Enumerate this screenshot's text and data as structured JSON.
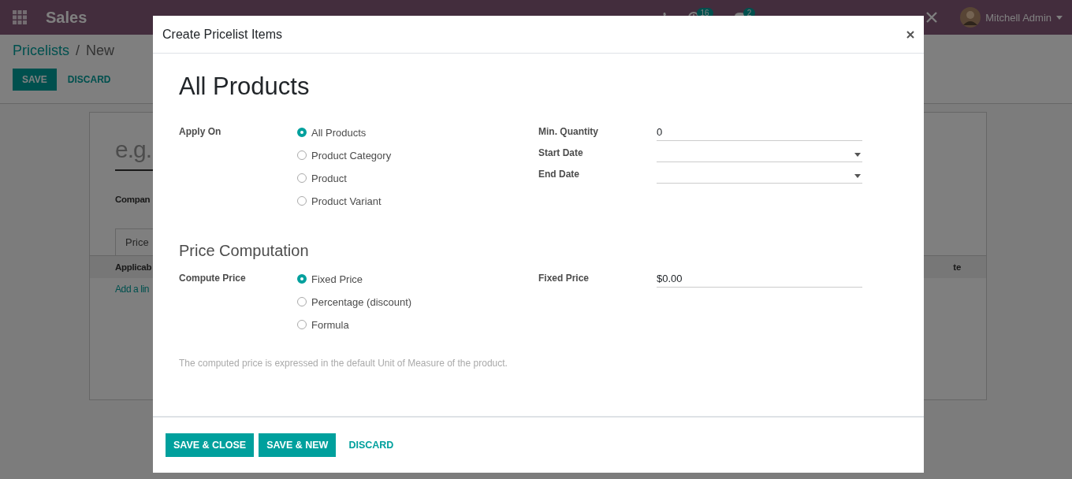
{
  "navbar": {
    "app_name": "Sales",
    "notifications": [
      {
        "kind": "activity",
        "count": "16"
      },
      {
        "kind": "messages",
        "count": "2"
      }
    ],
    "user": "Mitchell Admin"
  },
  "breadcrumb": {
    "parent": "Pricelists",
    "separator": "/",
    "current": "New"
  },
  "actions": [
    {
      "label": "SAVE",
      "kind": "primary"
    },
    {
      "label": "DISCARD",
      "kind": "link"
    }
  ],
  "form": {
    "name_placeholder": "e.g.",
    "company_label": "Compan",
    "tab": "Price",
    "columns": [
      "Applicab",
      "te"
    ],
    "add_line": "Add a lin"
  },
  "dialog": {
    "title": "Create Pricelist Items",
    "heading": "All Products",
    "apply_on": {
      "label": "Apply On",
      "options": [
        {
          "label": "All Products",
          "selected": true
        },
        {
          "label": "Product Category",
          "selected": false
        },
        {
          "label": "Product",
          "selected": false
        },
        {
          "label": "Product Variant",
          "selected": false
        }
      ]
    },
    "min_quantity": {
      "label": "Min. Quantity",
      "value": "0"
    },
    "start_date": {
      "label": "Start Date"
    },
    "end_date": {
      "label": "End Date"
    },
    "section_title": "Price Computation",
    "compute_price": {
      "label": "Compute Price",
      "options": [
        {
          "label": "Fixed Price",
          "selected": true
        },
        {
          "label": "Percentage (discount)",
          "selected": false
        },
        {
          "label": "Formula",
          "selected": false
        }
      ]
    },
    "fixed_price": {
      "label": "Fixed Price",
      "value": "$0.00"
    },
    "note": "The computed price is expressed in the default Unit of Measure of the product.",
    "buttons": [
      {
        "label": "SAVE & CLOSE",
        "kind": "primary"
      },
      {
        "label": "SAVE & NEW",
        "kind": "primary"
      },
      {
        "label": "DISCARD",
        "kind": "link"
      }
    ]
  }
}
